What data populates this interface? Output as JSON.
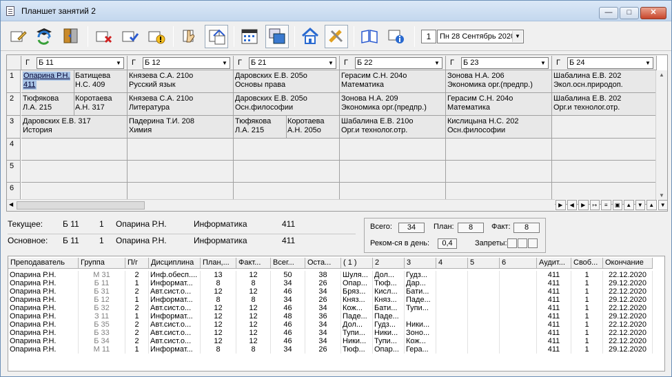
{
  "window": {
    "title": "Планшет занятий 2"
  },
  "toolbar": {
    "day_number": "1",
    "date_value": "Пн 28 Сентябрь 2020",
    "buttons": [
      "edit-icon",
      "teachers-icon",
      "refresh-icon",
      "door-icon",
      "delete-icon",
      "check-icon",
      "warning-icon",
      "hand-icon",
      "move-icon",
      "calendar-icon",
      "windows-icon",
      "home-icon",
      "tools-icon",
      "book-icon",
      "info-icon"
    ]
  },
  "grid": {
    "groups": [
      {
        "flag": "Г",
        "name": "Б 11"
      },
      {
        "flag": "Г",
        "name": "Б 12"
      },
      {
        "flag": "Г",
        "name": "Б 21"
      },
      {
        "flag": "Г",
        "name": "Б 22"
      },
      {
        "flag": "Г",
        "name": "Б 23"
      },
      {
        "flag": "Г",
        "name": "Б 24"
      }
    ],
    "row_numbers": [
      "1",
      "2",
      "3",
      "4",
      "5",
      "6"
    ],
    "cells": {
      "r1": [
        {
          "split": true,
          "a": [
            "Опарина Р.Н.",
            "411"
          ],
          "b": [
            "Батищева",
            "Н.С.   409"
          ]
        },
        {
          "lines": [
            "Князева С.А.   210о",
            "Русский язык"
          ]
        },
        {
          "lines": [
            "Даровских Е.В.   205о",
            "Основы права"
          ]
        },
        {
          "lines": [
            "Герасим С.Н.   204о",
            "Математика"
          ]
        },
        {
          "lines": [
            "Зонова Н.А.   206",
            "Экономика орг.(предпр.)"
          ]
        },
        {
          "lines": [
            "Шабалина Е.В.   202",
            "Экол.осн.природоп."
          ]
        }
      ],
      "r2": [
        {
          "split": true,
          "a": [
            "Тюфякова",
            "Л.А.   215"
          ],
          "b": [
            "Коротаева",
            "А.Н.   317"
          ]
        },
        {
          "lines": [
            "Князева С.А.   210о",
            "Литература"
          ]
        },
        {
          "lines": [
            "Даровских Е.В.   205о",
            "Осн.философии"
          ]
        },
        {
          "lines": [
            "Зонова Н.А.   209",
            "Экономика орг.(предпр.)"
          ]
        },
        {
          "lines": [
            "Герасим С.Н.   204о",
            "Математика"
          ]
        },
        {
          "lines": [
            "Шабалина Е.В.   202",
            "Орг.и технолог.отр."
          ]
        }
      ],
      "r3": [
        {
          "lines": [
            "Даровских Е.В.   317",
            "История"
          ]
        },
        {
          "lines": [
            "Падерина Т.И.   208",
            "Химия"
          ]
        },
        {
          "split": true,
          "a": [
            "Тюфякова",
            "Л.А.   215"
          ],
          "b": [
            "Коротаева",
            "А.Н.   205о"
          ]
        },
        {
          "lines": [
            "Шабалина Е.В.   210о",
            "Орг.и технолог.отр."
          ]
        },
        {
          "lines": [
            "Кислицына Н.С.   202",
            "Осн.философии"
          ]
        },
        {
          "lines": []
        }
      ]
    }
  },
  "info": {
    "current_label": "Текущее:",
    "current": {
      "group": "Б 11",
      "num": "1",
      "teacher": "Опарина Р.Н.",
      "discipline": "Информатика",
      "room": "411"
    },
    "main_label": "Основное:",
    "main": {
      "group": "Б 11",
      "num": "1",
      "teacher": "Опарина Р.Н.",
      "discipline": "Информатика",
      "room": "411"
    }
  },
  "stats": {
    "total_label": "Всего:",
    "total": "34",
    "plan_label": "План:",
    "plan": "8",
    "fact_label": "Факт:",
    "fact": "8",
    "rec_label": "Реком-ся в день:",
    "rec": "0,4",
    "ban_label": "Запреты:"
  },
  "table": {
    "headers": [
      "Преподаватель",
      "Группа",
      "П/г",
      "Дисциплина",
      "План,...",
      "Факт...",
      "Всег...",
      "Оста...",
      "( 1 )",
      "2",
      "3",
      "4",
      "5",
      "6",
      "Аудит...",
      "Своб...",
      "Окончание"
    ],
    "rows": [
      [
        "Опарина Р.Н.",
        "М 31",
        "2",
        "Инф.обесп....",
        "13",
        "12",
        "50",
        "38",
        "Шуля...",
        "Дол...",
        "Гудз...",
        "",
        "",
        "",
        "411",
        "1",
        "22.12.2020"
      ],
      [
        "Опарина Р.Н.",
        "Б 11",
        "1",
        "Информат...",
        "8",
        "8",
        "34",
        "26",
        "Опар...",
        "Тюф...",
        "Дар...",
        "",
        "",
        "",
        "411",
        "1",
        "29.12.2020"
      ],
      [
        "Опарина Р.Н.",
        "Б 31",
        "2",
        "Авт.сист.о...",
        "12",
        "12",
        "46",
        "34",
        "Бряз...",
        "Кисл...",
        "Бати...",
        "",
        "",
        "",
        "411",
        "1",
        "22.12.2020"
      ],
      [
        "Опарина Р.Н.",
        "Б 12",
        "1",
        "Информат...",
        "8",
        "8",
        "34",
        "26",
        "Княз...",
        "Княз...",
        "Паде...",
        "",
        "",
        "",
        "411",
        "1",
        "29.12.2020"
      ],
      [
        "Опарина Р.Н.",
        "Б 32",
        "2",
        "Авт.сист.о...",
        "12",
        "12",
        "46",
        "34",
        "Кож...",
        "Бати...",
        "Тупи...",
        "",
        "",
        "",
        "411",
        "1",
        "22.12.2020"
      ],
      [
        "Опарина Р.Н.",
        "З 11",
        "1",
        "Информат...",
        "12",
        "12",
        "48",
        "36",
        "Паде...",
        "Паде...",
        "",
        "",
        "",
        "",
        "411",
        "1",
        "29.12.2020"
      ],
      [
        "Опарина Р.Н.",
        "Б 35",
        "2",
        "Авт.сист.о...",
        "12",
        "12",
        "46",
        "34",
        "Дол...",
        "Гудз...",
        "Ники...",
        "",
        "",
        "",
        "411",
        "1",
        "22.12.2020"
      ],
      [
        "Опарина Р.Н.",
        "Б 33",
        "2",
        "Авт.сист.о...",
        "12",
        "12",
        "46",
        "34",
        "Тупи...",
        "Ники...",
        "Зоно...",
        "",
        "",
        "",
        "411",
        "1",
        "22.12.2020"
      ],
      [
        "Опарина Р.Н.",
        "Б 34",
        "2",
        "Авт.сист.о...",
        "12",
        "12",
        "46",
        "34",
        "Ники...",
        "Тупи...",
        "Кож...",
        "",
        "",
        "",
        "411",
        "1",
        "22.12.2020"
      ],
      [
        "Опарина Р.Н.",
        "М 11",
        "1",
        "Информат...",
        "8",
        "8",
        "34",
        "26",
        "Тюф...",
        "Опар...",
        "Гера...",
        "",
        "",
        "",
        "411",
        "1",
        "29.12.2020"
      ]
    ]
  }
}
